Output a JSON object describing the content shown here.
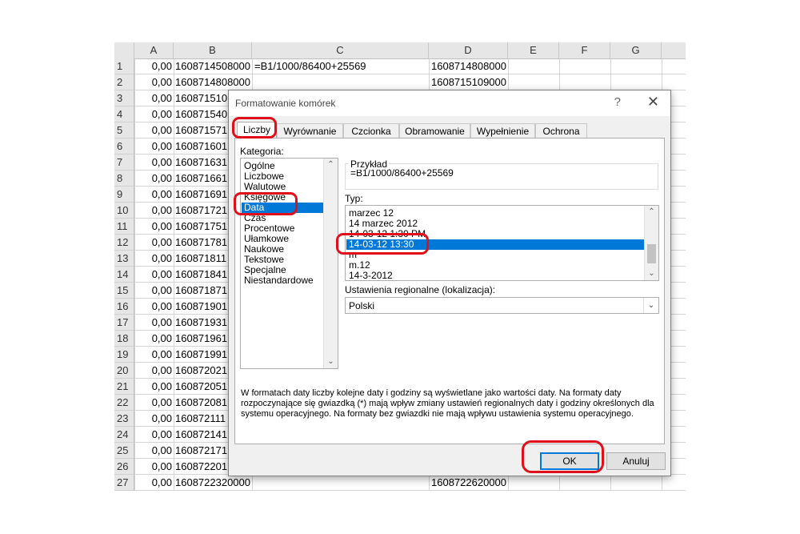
{
  "sheet": {
    "columns": [
      "A",
      "B",
      "C",
      "D",
      "E",
      "F",
      "G"
    ],
    "rows": [
      {
        "n": "1",
        "a": "0,00",
        "b": "1608714508000",
        "c": "=B1/1000/86400+25569",
        "d": "1608714808000"
      },
      {
        "n": "2",
        "a": "0,00",
        "b": "1608714808000",
        "c": "",
        "d": "1608715109000"
      },
      {
        "n": "3",
        "a": "0,00",
        "b": "160871510",
        "c": "",
        "d": ""
      },
      {
        "n": "4",
        "a": "0,00",
        "b": "160871540",
        "c": "",
        "d": ""
      },
      {
        "n": "5",
        "a": "0,00",
        "b": "160871571",
        "c": "",
        "d": ""
      },
      {
        "n": "6",
        "a": "0,00",
        "b": "160871601",
        "c": "",
        "d": ""
      },
      {
        "n": "7",
        "a": "0,00",
        "b": "160871631",
        "c": "",
        "d": ""
      },
      {
        "n": "8",
        "a": "0,00",
        "b": "160871661",
        "c": "",
        "d": ""
      },
      {
        "n": "9",
        "a": "0,00",
        "b": "160871691",
        "c": "",
        "d": ""
      },
      {
        "n": "10",
        "a": "0,00",
        "b": "160871721",
        "c": "",
        "d": ""
      },
      {
        "n": "11",
        "a": "0,00",
        "b": "160871751",
        "c": "",
        "d": ""
      },
      {
        "n": "12",
        "a": "0,00",
        "b": "160871781",
        "c": "",
        "d": ""
      },
      {
        "n": "13",
        "a": "0,00",
        "b": "160871811",
        "c": "",
        "d": ""
      },
      {
        "n": "14",
        "a": "0,00",
        "b": "160871841",
        "c": "",
        "d": ""
      },
      {
        "n": "15",
        "a": "0,00",
        "b": "160871871",
        "c": "",
        "d": ""
      },
      {
        "n": "16",
        "a": "0,00",
        "b": "160871901",
        "c": "",
        "d": ""
      },
      {
        "n": "17",
        "a": "0,00",
        "b": "160871931",
        "c": "",
        "d": ""
      },
      {
        "n": "18",
        "a": "0,00",
        "b": "160871961",
        "c": "",
        "d": ""
      },
      {
        "n": "19",
        "a": "0,00",
        "b": "160871991",
        "c": "",
        "d": ""
      },
      {
        "n": "20",
        "a": "0,00",
        "b": "160872021",
        "c": "",
        "d": ""
      },
      {
        "n": "21",
        "a": "0,00",
        "b": "160872051",
        "c": "",
        "d": ""
      },
      {
        "n": "22",
        "a": "0,00",
        "b": "160872081",
        "c": "",
        "d": ""
      },
      {
        "n": "23",
        "a": "0,00",
        "b": "160872111",
        "c": "",
        "d": ""
      },
      {
        "n": "24",
        "a": "0,00",
        "b": "160872141",
        "c": "",
        "d": ""
      },
      {
        "n": "25",
        "a": "0,00",
        "b": "160872171",
        "c": "",
        "d": ""
      },
      {
        "n": "26",
        "a": "0,00",
        "b": "160872201",
        "c": "",
        "d": ""
      },
      {
        "n": "27",
        "a": "0,00",
        "b": "1608722320000",
        "c": "",
        "d": "1608722620000"
      }
    ]
  },
  "dialog": {
    "title": "Formatowanie komórek",
    "help_glyph": "?",
    "close_glyph": "✕",
    "tabs": [
      "Liczby",
      "Wyrównanie",
      "Czcionka",
      "Obramowanie",
      "Wypełnienie",
      "Ochrona"
    ],
    "active_tab": "Liczby",
    "category_label": "Kategoria:",
    "categories": [
      "Ogólne",
      "Liczbowe",
      "Walutowe",
      "Księgowe",
      "Data",
      "Czas",
      "Procentowe",
      "Ułamkowe",
      "Naukowe",
      "Tekstowe",
      "Specjalne",
      "Niestandardowe"
    ],
    "selected_category": "Data",
    "sample_label": "Przykład",
    "sample_value": "=B1/1000/86400+25569",
    "type_label": "Typ:",
    "types": [
      "marzec 12",
      "14 marzec 2012",
      "14-03-12 1:30 PM",
      "14-03-12 13:30",
      "m",
      "m.12",
      "14-3-2012"
    ],
    "selected_type": "14-03-12 13:30",
    "locale_label": "Ustawienia regionalne (lokalizacja):",
    "locale_value": "Polski",
    "description": "W formatach daty liczby kolejne daty i godziny są wyświetlane jako wartości daty. Na formaty daty rozpoczynające się gwiazdką (*) mają wpływ zmiany ustawień regionalnych daty i godziny określonych dla systemu operacyjnego. Na formaty bez gwiazdki nie mają wpływu ustawienia systemu operacyjnego.",
    "ok_label": "OK",
    "cancel_label": "Anuluj"
  },
  "colors": {
    "selection": "#0078d7",
    "annotation": "#e0101a"
  }
}
